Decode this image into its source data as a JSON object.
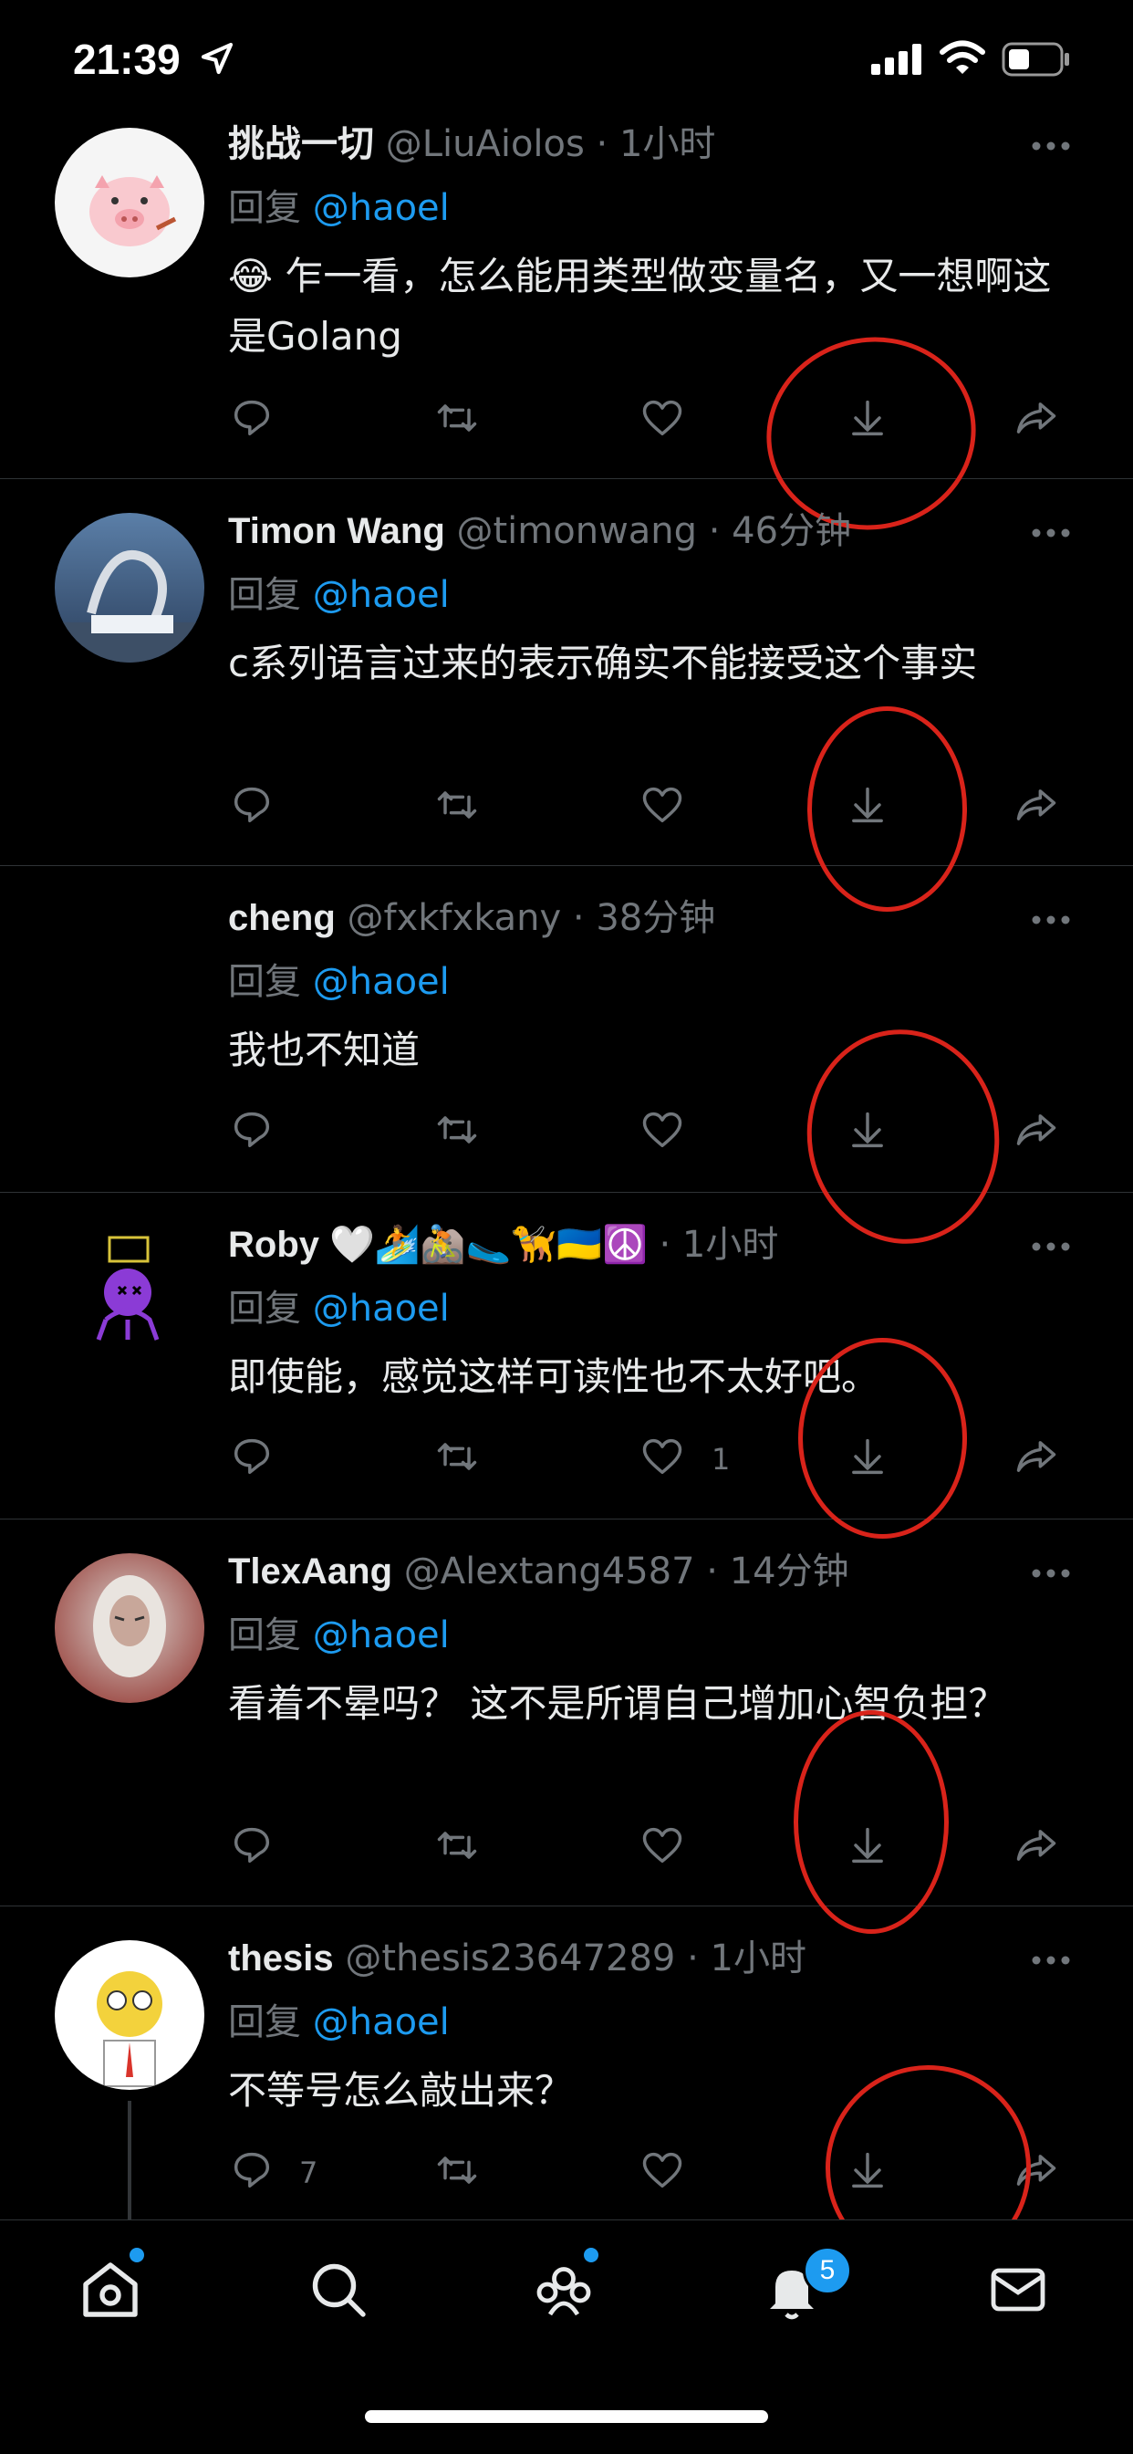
{
  "status_bar": {
    "time": "21:39"
  },
  "tweets": [
    {
      "name": "挑战一切",
      "meta": "@LiuAiolos · 1小时",
      "reply_label": "回复",
      "reply_to": "@haoel",
      "text": "😂 乍一看，怎么能用类型做变量名，又一想啊这是Golang",
      "reply_count": "",
      "like_count": ""
    },
    {
      "name": "Timon Wang",
      "meta": "@timonwang · 46分钟",
      "reply_label": "回复",
      "reply_to": "@haoel",
      "text": "c系列语言过来的表示确实不能接受这个事实",
      "reply_count": "",
      "like_count": ""
    },
    {
      "name": "cheng",
      "meta": "@fxkfxkany · 38分钟",
      "reply_label": "回复",
      "reply_to": "@haoel",
      "text": "我也不知道",
      "reply_count": "",
      "like_count": ""
    },
    {
      "name": "Roby 🤍🏄🚵🥿🦮🇺🇦☮️",
      "meta": "· 1小时",
      "reply_label": "回复",
      "reply_to": "@haoel",
      "text": "即使能，感觉这样可读性也不太好吧。",
      "reply_count": "",
      "like_count": "1"
    },
    {
      "name": "TlexAang",
      "meta": "@Alextang4587 · 14分钟",
      "reply_label": "回复",
      "reply_to": "@haoel",
      "text": "看着不晕吗？ 这不是所谓自己增加心智负担？",
      "reply_count": "",
      "like_count": ""
    },
    {
      "name": "thesis",
      "meta": "@thesis23647289 · 1小时",
      "reply_label": "回复",
      "reply_to": "@haoel",
      "text": "不等号怎么敲出来？",
      "reply_count": "7",
      "like_count": ""
    }
  ],
  "tab_bar": {
    "notifications_badge": "5"
  },
  "colors": {
    "background": "#000000",
    "accent": "#1d9bf0",
    "muted": "#71767b",
    "annotation": "#d9231a"
  },
  "icons": [
    "location-arrow-icon",
    "signal-icon",
    "wifi-icon",
    "battery-icon",
    "more-icon",
    "reply-icon",
    "retweet-icon",
    "heart-icon",
    "download-icon",
    "share-icon",
    "home-icon",
    "search-icon",
    "communities-icon",
    "bell-icon",
    "mail-icon"
  ]
}
